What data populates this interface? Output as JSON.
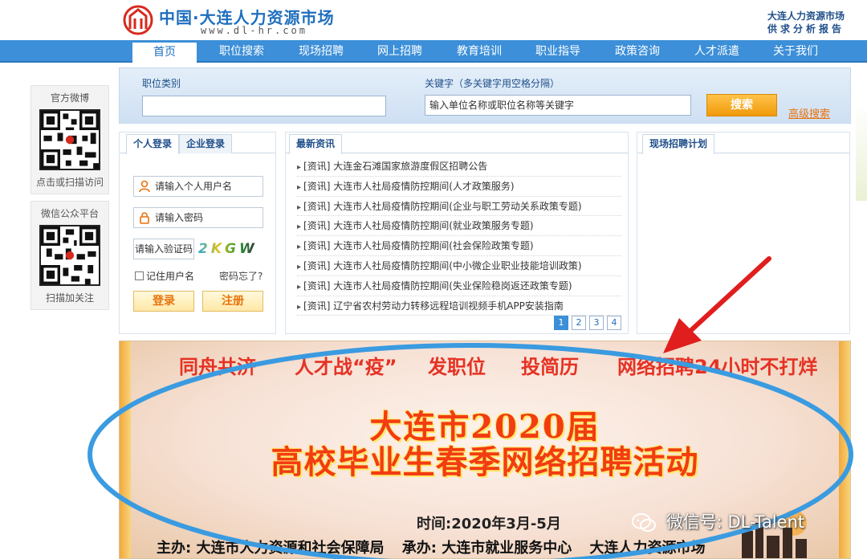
{
  "header": {
    "site_name": "中国·大连人力资源市场",
    "site_url": "www.dl-hr.com",
    "report_line1": "大连人力资源市场",
    "report_line2": "供求分析报告"
  },
  "nav": {
    "items": [
      "首页",
      "职位搜索",
      "现场招聘",
      "网上招聘",
      "教育培训",
      "职业指导",
      "政策咨询",
      "人才派遣",
      "关于我们"
    ]
  },
  "sidebar": {
    "weibo_title": "官方微博",
    "weibo_caption": "点击或扫描访问",
    "wechat_title": "微信公众平台",
    "wechat_caption": "扫描加关注"
  },
  "search": {
    "category_label": "职位类别",
    "category_value": "",
    "keyword_label": "关键字（多关键字用空格分隔）",
    "keyword_placeholder": "输入单位名称或职位名称等关键字",
    "search_button": "搜索",
    "advanced_link": "高级搜索"
  },
  "login": {
    "tab_personal": "个人登录",
    "tab_company": "企业登录",
    "username_placeholder": "请输入个人用户名",
    "password_placeholder": "请输入密码",
    "captcha_placeholder": "请输入验证码",
    "captcha_text": "2KGW",
    "remember_label": "记住用户名",
    "forgot_label": "密码忘了?",
    "login_button": "登录",
    "register_button": "注册"
  },
  "news": {
    "tab": "最新资讯",
    "items": [
      "[资讯] 大连金石滩国家旅游度假区招聘公告",
      "[资讯] 大连市人社局疫情防控期间(人才政策服务)",
      "[资讯] 大连市人社局疫情防控期间(企业与职工劳动关系政策专题)",
      "[资讯] 大连市人社局疫情防控期间(就业政策服务专题)",
      "[资讯] 大连市人社局疫情防控期间(社会保险政策专题)",
      "[资讯] 大连市人社局疫情防控期间(中小微企业职业技能培训政策)",
      "[资讯] 大连市人社局疫情防控期间(失业保险稳岗返还政策专题)",
      "[资讯] 辽宁省农村劳动力转移远程培训视频手机APP安装指南"
    ],
    "pages": [
      "1",
      "2",
      "3",
      "4"
    ],
    "current_page": "1"
  },
  "plan": {
    "tab": "现场招聘计划"
  },
  "banner": {
    "slogans": [
      "同舟共济",
      "人才战“疫”",
      "发职位",
      "投简历",
      "网络招聘24小时不打烊"
    ],
    "title_line1": "大连市2020届",
    "title_line2": "高校毕业生春季网络招聘活动",
    "time": "时间:2020年3月-5月",
    "organizer": "主办: 大连市人力资源和社会保障局",
    "undertaker": "承办: 大连市就业服务中心",
    "co_org": "大连人力资源市场"
  },
  "watermark": {
    "text": "微信号: DL-Talent"
  },
  "colors": {
    "brand_blue": "#3c8fd8",
    "accent_orange": "#f09a0a",
    "annotation_blue": "#3a9be0",
    "arrow_red": "#e01e1e"
  }
}
